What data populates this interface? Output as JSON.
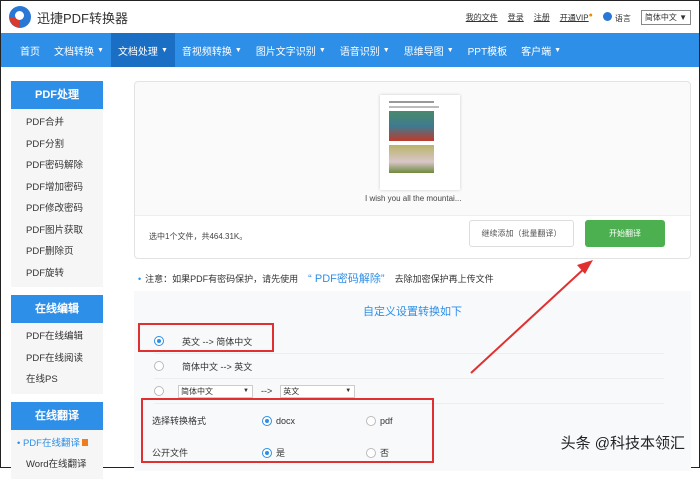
{
  "header": {
    "brand": "迅捷PDF转换器",
    "links": [
      "我的文件",
      "登录",
      "注册",
      "开通VIP"
    ],
    "lang_label": "语言",
    "lang_value": "简体中文 ▼"
  },
  "nav": [
    {
      "label": "首页",
      "caret": false
    },
    {
      "label": "文档转换",
      "caret": true
    },
    {
      "label": "文档处理",
      "caret": true,
      "active": true
    },
    {
      "label": "音视频转换",
      "caret": true
    },
    {
      "label": "图片文字识别",
      "caret": true
    },
    {
      "label": "语音识别",
      "caret": true
    },
    {
      "label": "思维导图",
      "caret": true
    },
    {
      "label": "PPT模板",
      "caret": false
    },
    {
      "label": "客户端",
      "caret": true
    }
  ],
  "sidebar": {
    "sections": [
      {
        "title": "PDF处理",
        "items": [
          "PDF合并",
          "PDF分割",
          "PDF密码解除",
          "PDF增加密码",
          "PDF修改密码",
          "PDF图片获取",
          "PDF删除页",
          "PDF旋转"
        ]
      },
      {
        "title": "在线编辑",
        "items": [
          "PDF在线编辑",
          "PDF在线阅读",
          "在线PS"
        ]
      },
      {
        "title": "在线翻译",
        "items": [
          "PDF在线翻译",
          "Word在线翻译"
        ]
      }
    ]
  },
  "upload": {
    "filename": "I wish you all the mountai...",
    "selected_info": "选中1个文件，共464.31K。",
    "add_button": "继续添加（批量翻译）",
    "start_button": "开始翻译"
  },
  "note": {
    "prefix": "注意：如果PDF有密码保护，请先使用",
    "link": "“ PDF密码解除”",
    "suffix": "去除加密保护再上传文件"
  },
  "settings": {
    "title": "自定义设置转换如下",
    "options": [
      "英文 --> 简体中文",
      "简体中文 --> 英文"
    ],
    "custom_from": "简体中文",
    "arrow": "-->",
    "custom_to": "英文",
    "format_label": "选择转换格式",
    "format_options": [
      "docx",
      "pdf"
    ],
    "public_label": "公开文件",
    "public_options": [
      "是",
      "否"
    ]
  },
  "watermark": "头条 @科技本领汇"
}
